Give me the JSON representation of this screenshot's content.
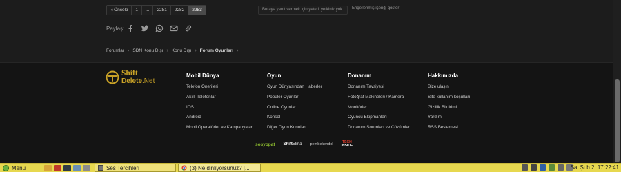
{
  "pagination": {
    "prev_label": "◂ Önceki",
    "pages": [
      "1",
      "...",
      "2281",
      "2282",
      "2283"
    ],
    "active_page": "2283"
  },
  "reply_notice": "Buraya yanıt vermek için yeterli yetkiniz yok.",
  "show_ignored_label": "Engellenmiş içeriği göster",
  "share": {
    "label": "Paylaş:",
    "icons": [
      "facebook-icon",
      "twitter-icon",
      "whatsapp-icon",
      "email-icon",
      "link-icon"
    ]
  },
  "breadcrumb": [
    {
      "label": "Forumlar",
      "current": false
    },
    {
      "label": "SDN Konu Dışı",
      "current": false
    },
    {
      "label": "Konu Dışı",
      "current": false
    },
    {
      "label": "Forum Oyunları",
      "current": true
    }
  ],
  "logo": {
    "line1": "Shift",
    "line2": "Delete",
    "line2_suffix": ".Net"
  },
  "footer_columns": [
    {
      "title": "Mobil Dünya",
      "links": [
        "Telefon Önerileri",
        "Akıllı Telefonlar",
        "IOS",
        "Android",
        "Mobil Operatörler ve Kampanyalar"
      ]
    },
    {
      "title": "Oyun",
      "links": [
        "Oyun Dünyasından Haberler",
        "Popüler Oyunlar",
        "Online Oyunlar",
        "Konsol",
        "Diğer Oyun Konuları"
      ]
    },
    {
      "title": "Donanım",
      "links": [
        "Donanım Tavsiyesi",
        "Fotoğraf Makineleri / Kamera",
        "Monitörler",
        "Oyuncu Ekipmanları",
        "Donanım Sorunları ve Çözümler"
      ]
    },
    {
      "title": "Hakkımızda",
      "links": [
        "Bize ulaşın",
        "Site kullanım koşulları",
        "Gizlilik Bildirimi",
        "Yardım",
        "RSS Beslemesi"
      ]
    }
  ],
  "partners": {
    "p1": "sosyopat",
    "p2a": "Shift",
    "p2b": "Elma",
    "p3": "pembekendol",
    "p4a": "TECH",
    "p4b": "INSIDE"
  },
  "taskbar": {
    "menu_label": "Menu",
    "tasks": [
      "Ses Tercihleri",
      "(3) Ne dinliyorsunuz? [..."
    ],
    "clock": "Sal Şub  2, 17:22:41"
  },
  "colors": {
    "accent_gold": "#c9a227",
    "taskbar_yellow": "#e7d84f"
  }
}
